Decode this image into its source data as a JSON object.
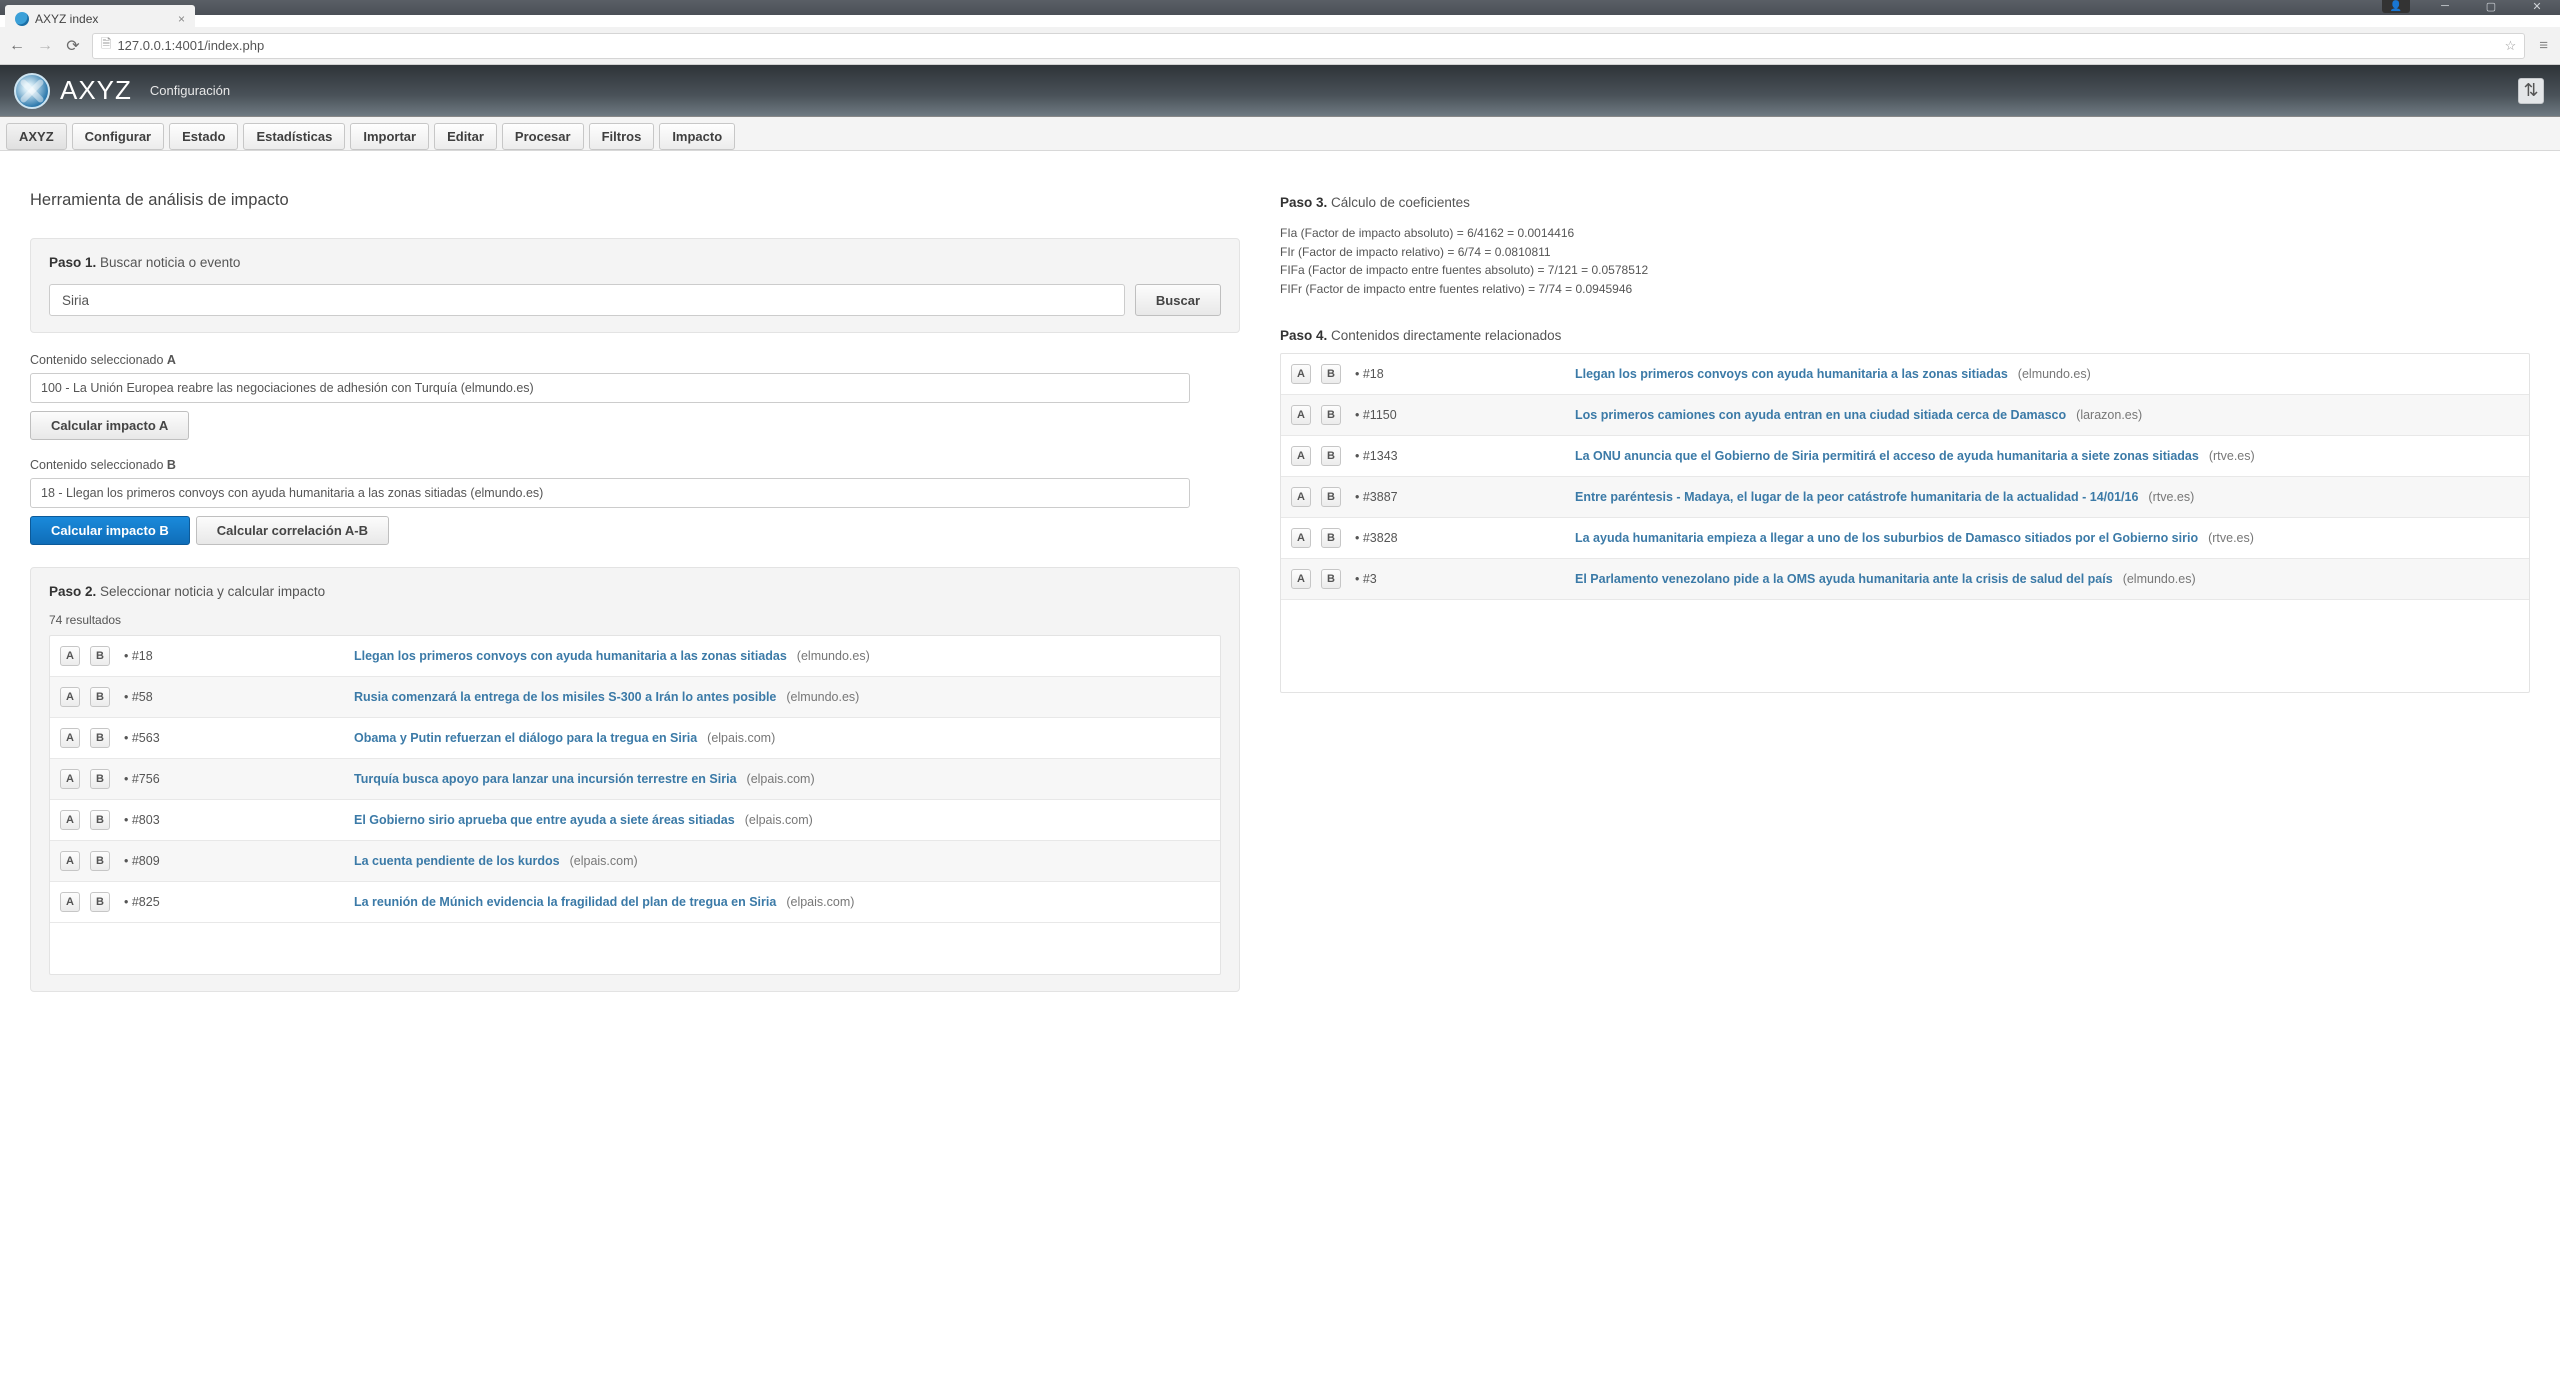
{
  "browser": {
    "tab_title": "AXYZ index",
    "url": "127.0.0.1:4001/index.php"
  },
  "header": {
    "app_name": "AXYZ",
    "subtitle": "Configuración"
  },
  "menu": [
    "AXYZ",
    "Configurar",
    "Estado",
    "Estadísticas",
    "Importar",
    "Editar",
    "Procesar",
    "Filtros",
    "Impacto"
  ],
  "page_title": "Herramienta de análisis de impacto",
  "step1": {
    "label_bold": "Paso 1.",
    "label_rest": "Buscar noticia o evento",
    "search_value": "Siria",
    "search_btn": "Buscar"
  },
  "selA": {
    "label": "Contenido seleccionado",
    "letter": "A",
    "value": "100 - La Unión Europea reabre las negociaciones de adhesión con Turquía (elmundo.es)",
    "calc_btn": "Calcular impacto A"
  },
  "selB": {
    "label": "Contenido seleccionado",
    "letter": "B",
    "value": "18 - Llegan los primeros convoys con ayuda humanitaria a las zonas sitiadas (elmundo.es)",
    "calc_btn": "Calcular impacto B",
    "corr_btn": "Calcular correlación A-B"
  },
  "step2": {
    "label_bold": "Paso 2.",
    "label_rest": "Seleccionar noticia y calcular impacto",
    "count": "74 resultados",
    "rows": [
      {
        "id": "#18",
        "title": "Llegan los primeros convoys con ayuda humanitaria a las zonas sitiadas",
        "src": "(elmundo.es)"
      },
      {
        "id": "#58",
        "title": "Rusia comenzará la entrega de los misiles S-300 a Irán lo antes posible",
        "src": "(elmundo.es)"
      },
      {
        "id": "#563",
        "title": "Obama y Putin refuerzan el diálogo para la tregua en Siria",
        "src": "(elpais.com)"
      },
      {
        "id": "#756",
        "title": "Turquía busca apoyo para lanzar una incursión terrestre en Siria",
        "src": "(elpais.com)"
      },
      {
        "id": "#803",
        "title": "El Gobierno sirio aprueba que entre ayuda a siete áreas sitiadas",
        "src": "(elpais.com)"
      },
      {
        "id": "#809",
        "title": "La cuenta pendiente de los kurdos",
        "src": "(elpais.com)"
      },
      {
        "id": "#825",
        "title": "La reunión de Múnich evidencia la fragilidad del plan de tregua en Siria",
        "src": "(elpais.com)"
      }
    ]
  },
  "step3": {
    "label_bold": "Paso 3.",
    "label_rest": "Cálculo de coeficientes",
    "lines": [
      "FIa (Factor de impacto absoluto) = 6/4162 = 0.0014416",
      "FIr (Factor de impacto relativo) = 6/74 = 0.0810811",
      "FIFa (Factor de impacto entre fuentes absoluto) = 7/121 = 0.0578512",
      "FIFr (Factor de impacto entre fuentes relativo) = 7/74 = 0.0945946"
    ]
  },
  "step4": {
    "label_bold": "Paso 4.",
    "label_rest": "Contenidos directamente relacionados",
    "rows": [
      {
        "id": "#18",
        "title": "Llegan los primeros convoys con ayuda humanitaria a las zonas sitiadas",
        "src": "(elmundo.es)"
      },
      {
        "id": "#1150",
        "title": "Los primeros camiones con ayuda entran en una ciudad sitiada cerca de Damasco",
        "src": "(larazon.es)"
      },
      {
        "id": "#1343",
        "title": "La ONU anuncia que el Gobierno de Siria permitirá el acceso de ayuda humanitaria a siete zonas sitiadas",
        "src": "(rtve.es)"
      },
      {
        "id": "#3887",
        "title": "Entre paréntesis - Madaya, el lugar de la peor catástrofe humanitaria de la actualidad - 14/01/16",
        "src": "(rtve.es)"
      },
      {
        "id": "#3828",
        "title": "La ayuda humanitaria empieza a llegar a uno de los suburbios de Damasco sitiados por el Gobierno sirio",
        "src": "(rtve.es)"
      },
      {
        "id": "#3",
        "title": "El Parlamento venezolano pide a la OMS ayuda humanitaria ante la crisis de salud del país",
        "src": "(elmundo.es)"
      }
    ]
  },
  "ab": {
    "a": "A",
    "b": "B",
    "bullet": "•"
  }
}
